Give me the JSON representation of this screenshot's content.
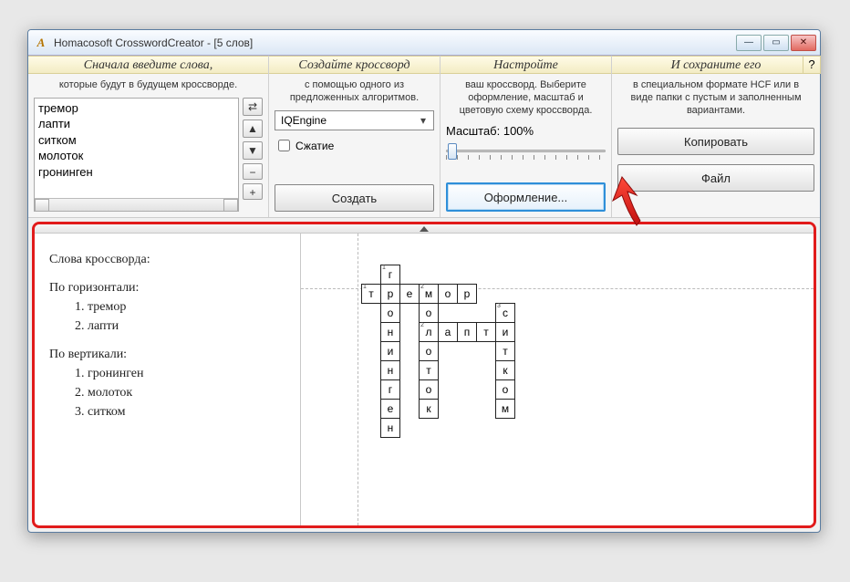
{
  "title": "Homacosoft CrosswordCreator - [5 слов]",
  "help_label": "?",
  "steps": {
    "s1": {
      "head": "Сначала введите слова,",
      "desc": "которые будут в будущем кроссворде.",
      "words": [
        "тремор",
        "лапти",
        "ситком",
        "молоток",
        "гронинген"
      ],
      "btn_shuffle": "⇄",
      "btn_up": "▲",
      "btn_down": "▼",
      "btn_minus": "−",
      "btn_plus": "+"
    },
    "s2": {
      "head": "Создайте кроссворд",
      "desc": "с помощью одного из предложенных алгоритмов.",
      "engine": "IQEngine",
      "compress": "Сжатие",
      "create": "Создать"
    },
    "s3": {
      "head": "Настройте",
      "desc": "ваш кроссворд. Выберите оформление, масштаб и цветовую схему кроссворда.",
      "scale": "Масштаб: 100%",
      "design": "Оформление..."
    },
    "s4": {
      "head": "И сохраните его",
      "desc": "в специальном формате HCF или в виде папки с пустым и заполненным вариантами.",
      "copy": "Копировать",
      "file": "Файл"
    }
  },
  "clues": {
    "title": "Слова кроссворда:",
    "hhead": "По горизонтали:",
    "h": [
      "1. тремор",
      "2. лапти"
    ],
    "vhead": "По вертикали:",
    "v": [
      "1. гронинген",
      "2. молоток",
      "3. ситком"
    ]
  },
  "chart_data": {
    "type": "crossword",
    "cell_size_px": 21,
    "across": [
      {
        "num": 1,
        "row": 1,
        "col": 0,
        "answer": "тремор"
      },
      {
        "num": 2,
        "row": 3,
        "col": 3,
        "answer": "лапти"
      }
    ],
    "down": [
      {
        "num": 1,
        "row": 0,
        "col": 1,
        "answer": "гронинген"
      },
      {
        "num": 2,
        "row": 1,
        "col": 3,
        "answer": "молоток"
      },
      {
        "num": 3,
        "row": 2,
        "col": 7,
        "answer": "ситком"
      }
    ]
  }
}
